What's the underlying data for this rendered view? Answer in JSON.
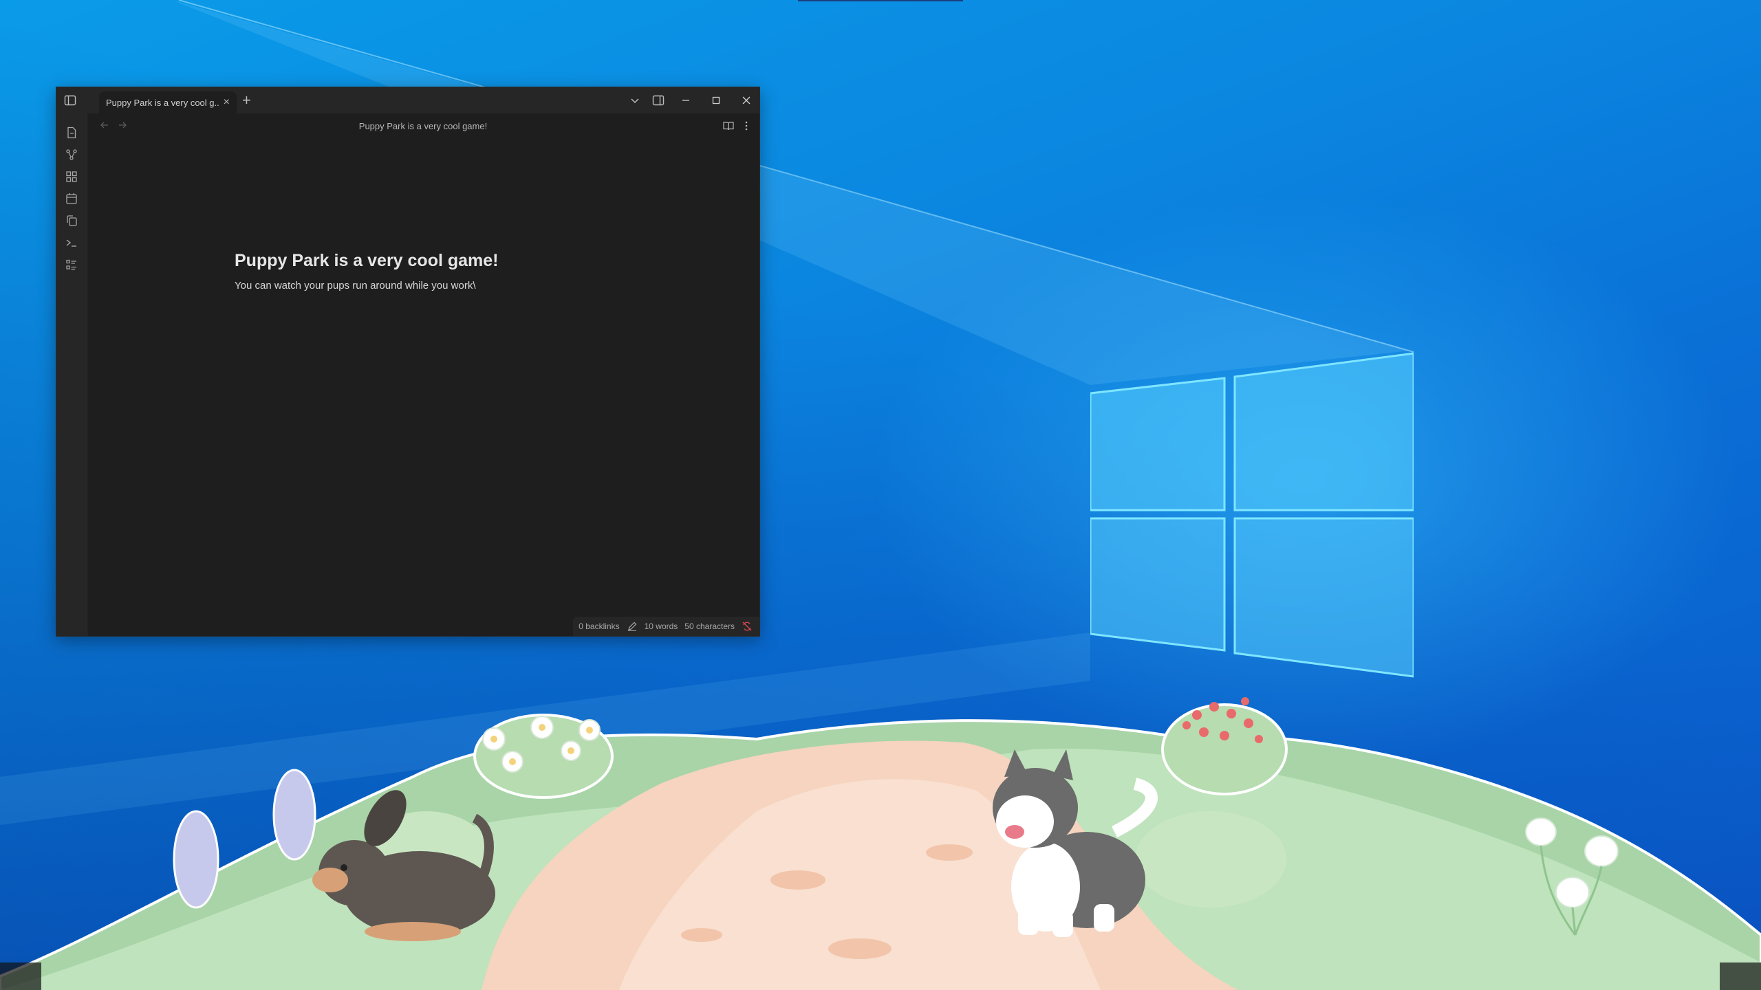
{
  "window": {
    "tab_title": "Puppy Park is a very cool g...",
    "tab_close": "×",
    "new_tab": "+",
    "view_title": "Puppy Park is a very cool game!"
  },
  "note": {
    "heading": "Puppy Park is a very cool game!",
    "body": "You can watch your pups run around while you work\\"
  },
  "status_bar": {
    "backlinks": "0 backlinks",
    "words": "10 words",
    "characters": "50 characters"
  },
  "ribbon": {
    "icons": [
      "file-icon",
      "graph-icon",
      "layout-icon",
      "calendar-icon",
      "copy-icon",
      "terminal-icon",
      "list-icon"
    ]
  },
  "colors": {
    "editor_bg": "#1e1e1e",
    "chrome_bg": "#262626",
    "desktop_blue": "#0a86e0"
  }
}
